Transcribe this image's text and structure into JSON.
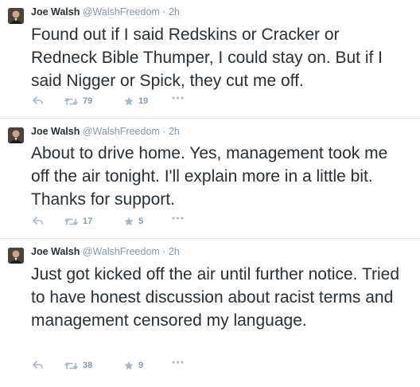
{
  "tweets": [
    {
      "name": "Joe Walsh",
      "handle": "@WalshFreedom",
      "separator": "·",
      "time": "2h",
      "text": "Found out if I said Redskins or Cracker or Redneck Bible Thumper, I could stay on. But if I said Nigger or Spick, they cut me off.",
      "retweets": "79",
      "favorites": "19"
    },
    {
      "name": "Joe Walsh",
      "handle": "@WalshFreedom",
      "separator": "·",
      "time": "2h",
      "text": "About to drive home. Yes, management took me off the air tonight. I'll explain more in a little bit. Thanks for support.",
      "retweets": "17",
      "favorites": "5"
    },
    {
      "name": "Joe Walsh",
      "handle": "@WalshFreedom",
      "separator": "·",
      "time": "2h",
      "text": "Just got kicked off the air until further notice. Tried to have honest discussion about racist terms and management censored my language.",
      "retweets": "38",
      "favorites": "9"
    }
  ],
  "icons": {
    "reply": "reply-icon",
    "retweet": "retweet-icon",
    "favorite": "star-icon",
    "more": "more-dots-icon"
  },
  "colors": {
    "text": "#292f33",
    "muted": "#8899a6",
    "divider": "#e1e8ed"
  }
}
